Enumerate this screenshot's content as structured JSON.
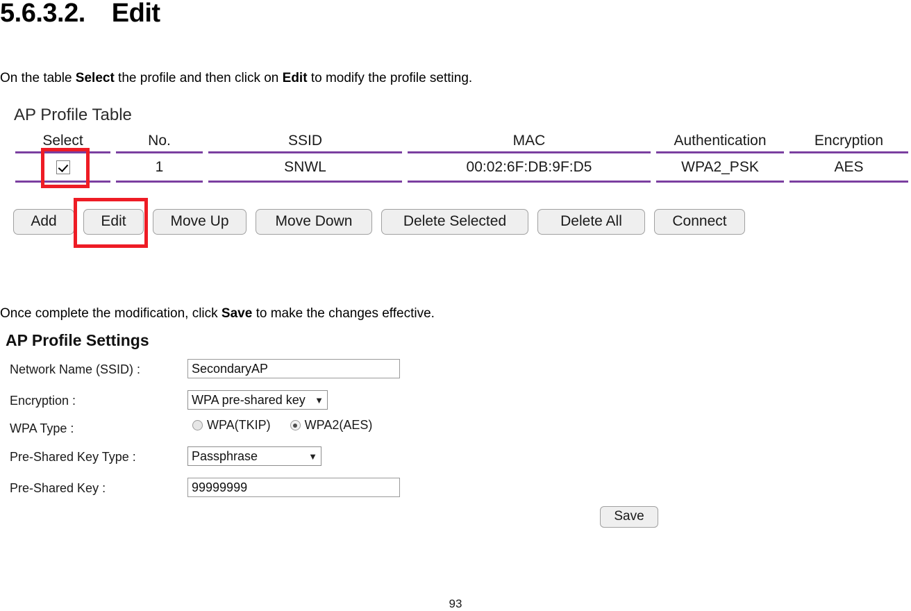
{
  "document": {
    "section_number": "5.6.3.2.",
    "section_title": "Edit",
    "intro_parts": {
      "p1": "On the table ",
      "b1": "Select",
      "p2": " the profile and then click on ",
      "b2": "Edit",
      "p3": " to modify the profile setting."
    },
    "save_parts": {
      "p1": "Once complete the modification, click ",
      "b1": "Save",
      "p2": " to make the changes effective."
    },
    "page_number": "93"
  },
  "profile_table": {
    "title": "AP Profile Table",
    "columns": [
      "Select",
      "No.",
      "SSID",
      "MAC",
      "Authentication",
      "Encryption"
    ],
    "rows": [
      {
        "selected": true,
        "no": "1",
        "ssid": "SNWL",
        "mac": "00:02:6F:DB:9F:D5",
        "authentication": "WPA2_PSK",
        "encryption": "AES"
      }
    ],
    "line_color": "#7b3fa0",
    "highlight_color": "#ee1c25"
  },
  "toolbar": {
    "add_label": "Add",
    "edit_label": "Edit",
    "move_up_label": "Move Up",
    "move_down_label": "Move Down",
    "delete_selected_label": "Delete Selected",
    "delete_all_label": "Delete All",
    "connect_label": "Connect"
  },
  "settings": {
    "title": "AP Profile Settings",
    "ssid_label": "Network Name (SSID) :",
    "ssid_value": "SecondaryAP",
    "encryption_label": "Encryption :",
    "encryption_value": "WPA pre-shared key",
    "wpa_type_label": "WPA Type :",
    "wpa_tkip_label": "WPA(TKIP)",
    "wpa_aes_label": "WPA2(AES)",
    "psk_type_label": "Pre-Shared Key Type :",
    "psk_type_value": "Passphrase",
    "psk_label": "Pre-Shared Key :",
    "psk_value": "99999999",
    "arrow_glyph": "▼",
    "save_label": "Save"
  }
}
